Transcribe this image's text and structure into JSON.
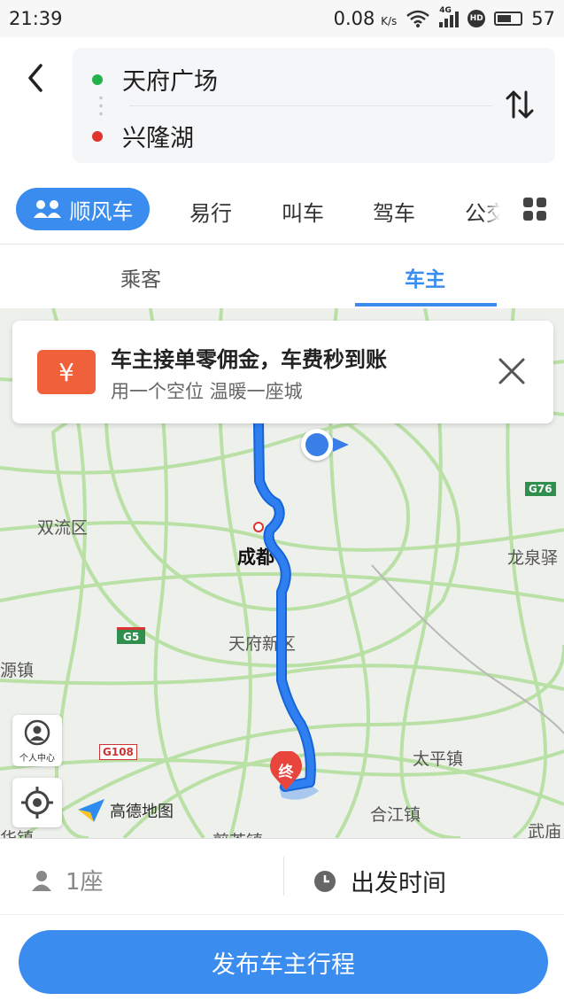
{
  "status_bar": {
    "time": "21:39",
    "speed": "0.08",
    "speed_unit": "K/s",
    "signal_label": "4G",
    "hd_label": "HD",
    "battery": "57"
  },
  "route": {
    "origin": "天府广场",
    "destination": "兴隆湖"
  },
  "modes": {
    "active": "顺风车",
    "items": [
      "易行",
      "叫车",
      "驾车",
      "公交"
    ]
  },
  "role_tabs": {
    "passenger": "乘客",
    "driver": "车主",
    "active": "车主"
  },
  "banner": {
    "icon_glyph": "¥",
    "title": "车主接单零佣金，车费秒到账",
    "subtitle": "用一个空位 温暖一座城"
  },
  "map": {
    "labels": {
      "shuangliu": "双流区",
      "chengdu": "成都",
      "tianfu": "天府新区",
      "longquan": "龙泉驿",
      "yuanzhen": "源镇",
      "taiping": "太平镇",
      "hejiang": "合江镇",
      "wumiao": "武庙",
      "huazhen": "华镇",
      "bottom_town": "煎茶镇"
    },
    "shields": {
      "g5": "G5",
      "g76": "G76",
      "g108": "G108"
    },
    "end_marker": "终",
    "personal_center": "个人中心",
    "logo": "高德地图",
    "colors": {
      "road": "#b9e0a5",
      "route": "#2f7ff0",
      "water": "#a8c8ef"
    }
  },
  "bottom": {
    "seats": "1座",
    "departure_time": "出发时间"
  },
  "publish_label": "发布车主行程",
  "colors": {
    "accent": "#3a8dee",
    "origin_dot": "#22b34d",
    "destination_dot": "#e0342c",
    "banner_icon": "#f0603a"
  }
}
